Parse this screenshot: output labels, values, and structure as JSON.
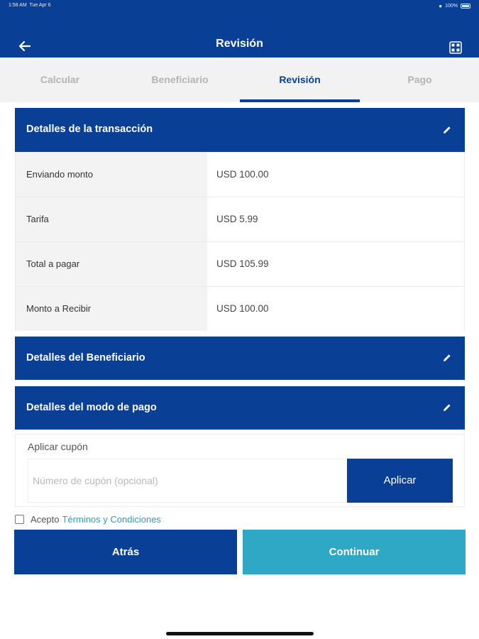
{
  "status_bar": {
    "time": "1:58 AM",
    "date": "Tue Apr 6",
    "battery": "100%"
  },
  "header": {
    "title": "Revisión",
    "back_icon": "arrow-left-icon",
    "qr_icon": "qr-code-icon"
  },
  "tabs": [
    {
      "label": "Calcular",
      "active": false
    },
    {
      "label": "Beneficiario",
      "active": false
    },
    {
      "label": "Revisión",
      "active": true
    },
    {
      "label": "Pago",
      "active": false
    }
  ],
  "transaction": {
    "title": "Detalles de la transacción",
    "rows": [
      {
        "label": "Enviando monto",
        "value": "USD 100.00"
      },
      {
        "label": "Tarifa",
        "value": "USD 5.99"
      },
      {
        "label": "Total a pagar",
        "value": "USD 105.99"
      },
      {
        "label": "Monto a Recibir",
        "value": "USD 100.00"
      }
    ]
  },
  "beneficiary": {
    "title": "Detalles del Beneficiario"
  },
  "payment_mode": {
    "title": "Detalles del modo de pago"
  },
  "coupon": {
    "label": "Aplicar cupón",
    "placeholder": "Número de cupón (opcional)",
    "value": "",
    "apply_label": "Aplicar"
  },
  "terms": {
    "prefix": "Acepto",
    "link": "Términos y Condiciones",
    "checked": false
  },
  "actions": {
    "back_label": "Atrás",
    "continue_label": "Continuar"
  },
  "colors": {
    "primary": "#0a3f96",
    "accent": "#2fa8c6",
    "link": "#2a9dc5"
  }
}
